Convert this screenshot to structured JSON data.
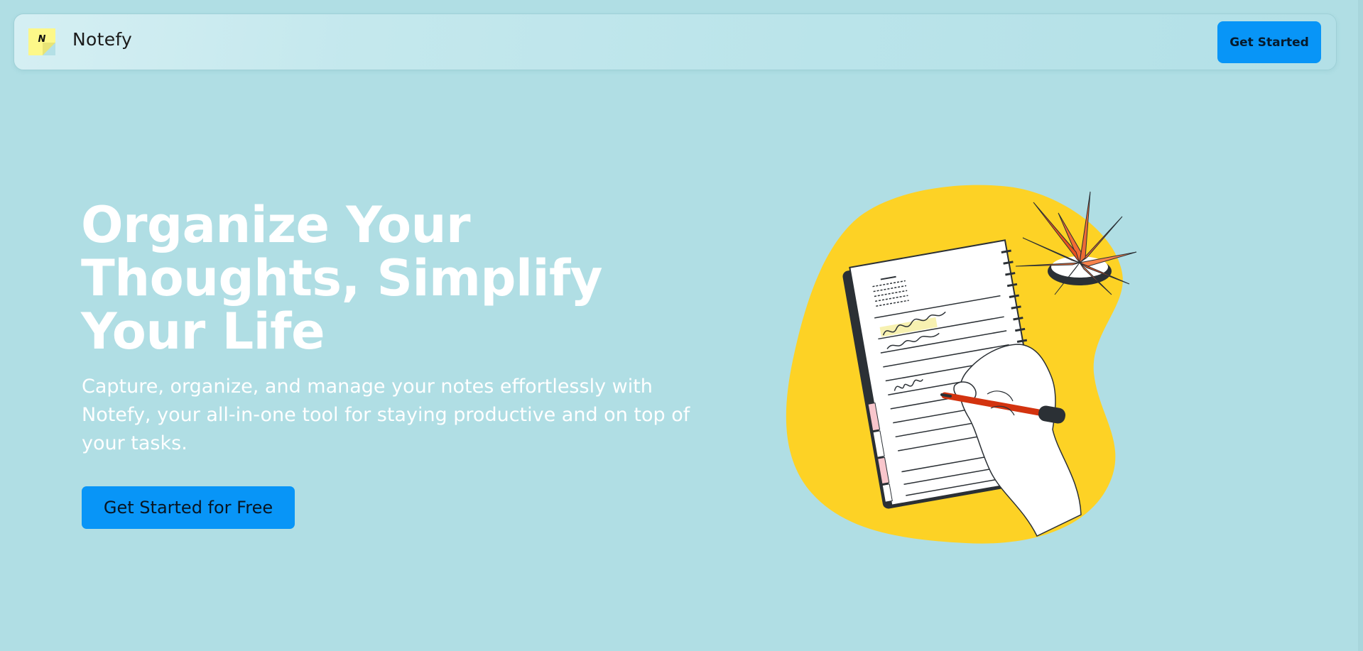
{
  "navbar": {
    "logo_letter": "N",
    "brand": "Notefy",
    "cta_label": "Get Started"
  },
  "hero": {
    "title": "Organize Your Thoughts, Simplify Your Life",
    "subtitle": "Capture, organize, and manage your notes effortlessly with Notefy, your all-in-one tool for staying productive and on top of your tasks.",
    "cta_label": "Get Started for Free"
  },
  "colors": {
    "background": "#b0dee4",
    "accent": "#0895f7",
    "blob": "#fdd225",
    "logo": "#fdf889"
  }
}
